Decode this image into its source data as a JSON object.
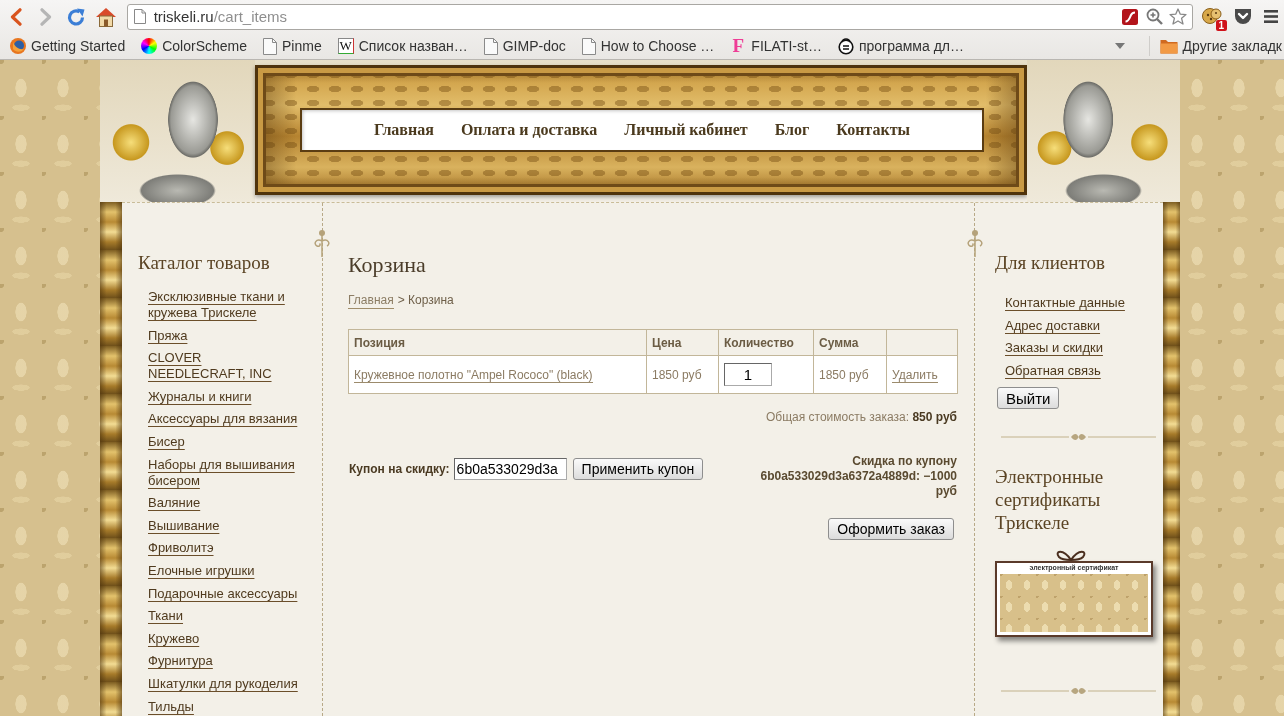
{
  "browser": {
    "back": {
      "disabled": false
    },
    "forward": {
      "disabled": true
    },
    "url_host": "triskeli.ru",
    "url_path": "/cart_items",
    "extension_badge": "1",
    "bookmarks": [
      {
        "kind": "firefox",
        "label": "Getting Started"
      },
      {
        "kind": "colorwheel",
        "label": "ColorScheme"
      },
      {
        "kind": "page",
        "label": "Pinme"
      },
      {
        "kind": "wiki",
        "glyph": "W",
        "label": "Список назван…"
      },
      {
        "kind": "page",
        "label": "GIMP-doc"
      },
      {
        "kind": "page",
        "label": "How to Choose …"
      },
      {
        "kind": "letter",
        "glyph": "F",
        "label": "FILATI-st…"
      },
      {
        "kind": "program",
        "label": "программа дл…"
      }
    ],
    "other_bookmarks": "Другие закладк"
  },
  "nav": [
    "Главная",
    "Оплата и доставка",
    "Личный кабинет",
    "Блог",
    "Контакты"
  ],
  "catalog": {
    "title": "Каталог товаров",
    "items": [
      "Эксклюзивные ткани и кружева Трискеле",
      "Пряжа",
      "CLOVER NEEDLECRAFT, INC",
      "Журналы и книги",
      "Аксессуары для вязания",
      "Бисер",
      "Наборы для вышивания бисером",
      "Валяние",
      "Вышивание",
      "Фриволитэ",
      "Елочные игрушки",
      "Подарочные аксессуары",
      "Ткани",
      "Кружево",
      "Фурнитура",
      "Шкатулки для рукоделия",
      "Тильды"
    ]
  },
  "cart": {
    "title": "Корзина",
    "breadcrumb": {
      "link": "Главная",
      "current": "> Корзина"
    },
    "table": {
      "columns": [
        "Позиция",
        "Цена",
        "Количество",
        "Сумма"
      ],
      "rows": [
        {
          "cells": [
            {
              "kind": "product_link",
              "text": "Кружевное полотно \"Ampel Rococo\" (black)"
            },
            {
              "kind": "text",
              "text": "1850 руб"
            },
            {
              "kind": "input",
              "text": "1"
            },
            {
              "kind": "text",
              "text": "1850 руб"
            },
            {
              "kind": "delete_link",
              "text": "Удалить"
            }
          ]
        }
      ]
    },
    "total": "Общая стоимость заказа: **850 руб**",
    "coupon": {
      "label": "Купон на скидку:",
      "value": "6b0a533029d3a",
      "button": "Применить купон"
    },
    "discount": "Скидка по купону 6b0a533029d3a6372a4889d: −1000 руб",
    "checkout_button": "Оформить заказ"
  },
  "clients": {
    "title": "Для клиентов",
    "links": [
      "Контактные данные",
      "Адрес доставки",
      "Заказы и скидки",
      "Обратная связь"
    ],
    "logout_button": "Выйти"
  },
  "certificates": {
    "title": "Электронные сертификаты Трискеле",
    "card_label": "электронный сертификат"
  }
}
